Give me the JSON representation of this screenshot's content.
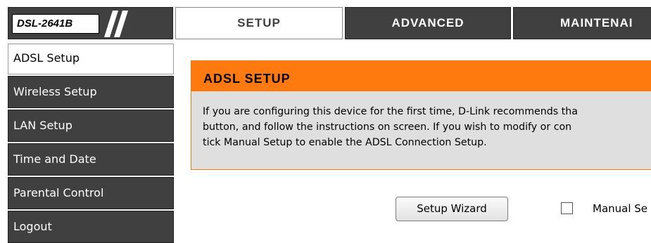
{
  "header": {
    "model": "DSL-2641B",
    "tabs": [
      {
        "label": "SETUP",
        "active": true
      },
      {
        "label": "ADVANCED",
        "active": false
      },
      {
        "label": "MAINTENAI",
        "active": false
      }
    ]
  },
  "sidebar": {
    "items": [
      {
        "label": "ADSL Setup",
        "active": true
      },
      {
        "label": "Wireless Setup"
      },
      {
        "label": "LAN Setup"
      },
      {
        "label": "Time and Date"
      },
      {
        "label": "Parental Control"
      },
      {
        "label": "Logout"
      }
    ]
  },
  "main": {
    "section_title": "ADSL SETUP",
    "description_lines": [
      "If you are configuring this device for the first time, D-Link recommends tha",
      "button, and follow the instructions on screen. If you wish to modify or con",
      "tick Manual Setup to enable the ADSL Connection Setup."
    ],
    "wizard_button": "Setup Wizard",
    "manual_setup_label": "Manual Se",
    "manual_setup_checked": false
  },
  "colors": {
    "nav_dark": "#404040",
    "accent_orange": "#ff7a0e",
    "section_bg": "#dfdfdf"
  },
  "icons": {
    "logo_slashes": "slashes-icon"
  }
}
